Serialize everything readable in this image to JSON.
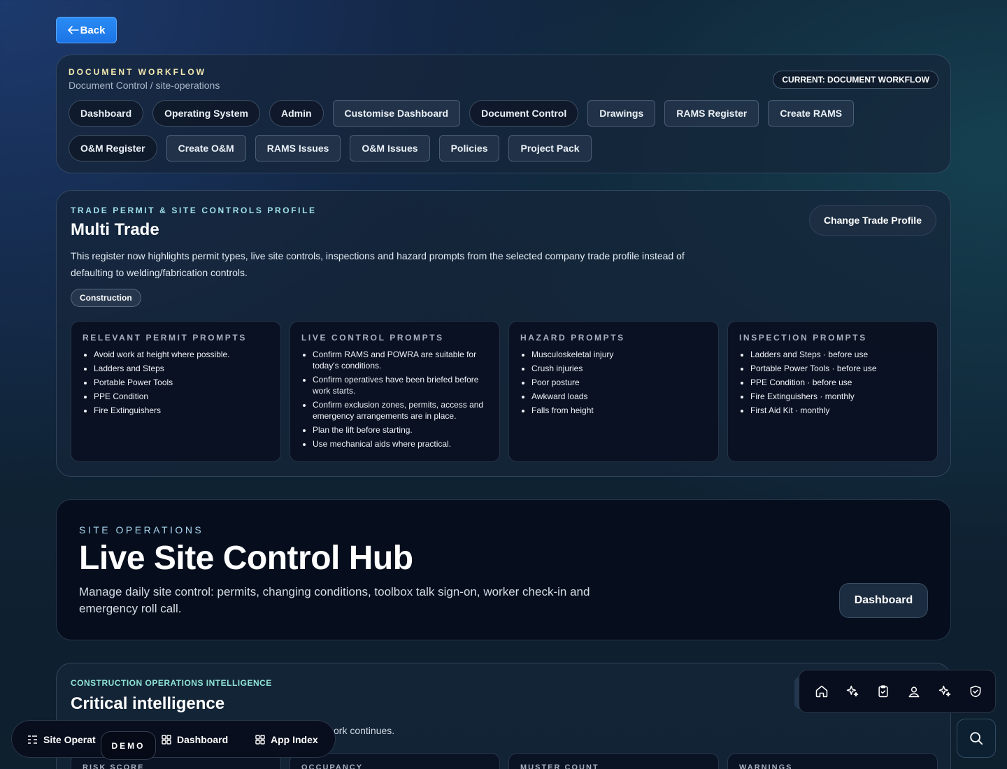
{
  "back": {
    "label": "Back"
  },
  "workflow": {
    "eyebrow": "DOCUMENT WORKFLOW",
    "path": "Document Control / site-operations",
    "current": "CURRENT: DOCUMENT WORKFLOW",
    "chips": [
      {
        "label": "Dashboard"
      },
      {
        "label": "Operating System"
      },
      {
        "label": "Admin"
      },
      {
        "label": "Customise Dashboard"
      },
      {
        "label": "Document Control"
      },
      {
        "label": "Drawings"
      },
      {
        "label": "RAMS Register"
      },
      {
        "label": "Create RAMS"
      },
      {
        "label": "O&M Register"
      },
      {
        "label": "Create O&M"
      },
      {
        "label": "RAMS Issues"
      },
      {
        "label": "O&M Issues"
      },
      {
        "label": "Policies"
      },
      {
        "label": "Project Pack"
      }
    ]
  },
  "trade_profile": {
    "eyebrow": "TRADE PERMIT & SITE CONTROLS PROFILE",
    "title": "Multi Trade",
    "description": "This register now highlights permit types, live site controls, inspections and hazard prompts from the selected company trade profile instead of defaulting to welding/fabrication controls.",
    "change_button": "Change Trade Profile",
    "tag": "Construction",
    "cards": [
      {
        "heading": "RELEVANT PERMIT PROMPTS",
        "items": [
          "Avoid work at height where possible.",
          "Ladders and Steps",
          "Portable Power Tools",
          "PPE Condition",
          "Fire Extinguishers"
        ]
      },
      {
        "heading": "LIVE CONTROL PROMPTS",
        "items": [
          "Confirm RAMS and POWRA are suitable for today's conditions.",
          "Confirm operatives have been briefed before work starts.",
          "Confirm exclusion zones, permits, access and emergency arrangements are in place.",
          "Plan the lift before starting.",
          "Use mechanical aids where practical."
        ]
      },
      {
        "heading": "HAZARD PROMPTS",
        "items": [
          "Musculoskeletal injury",
          "Crush injuries",
          "Poor posture",
          "Awkward loads",
          "Falls from height"
        ]
      },
      {
        "heading": "INSPECTION PROMPTS",
        "items": [
          "Ladders and Steps · before use",
          "Portable Power Tools · before use",
          "PPE Condition · before use",
          "Fire Extinguishers · monthly",
          "First Aid Kit · monthly"
        ]
      }
    ]
  },
  "hub": {
    "eyebrow": "SITE OPERATIONS",
    "title": "Live Site Control Hub",
    "description": "Manage daily site control: permits, changing conditions, toolbox talk sign-on, worker check-in and emergency roll call.",
    "button": "Dashboard"
  },
  "intelligence": {
    "eyebrow": "CONSTRUCTION OPERATIONS INTELLIGENCE",
    "title": "Critical intelligence",
    "description_fragment": "ork continues.",
    "cards": [
      "RISK SCORE",
      "OCCUPANCY",
      "MUSTER COUNT",
      "WARNINGS"
    ]
  },
  "dock": {
    "items": [
      {
        "label": "Site Operat",
        "icon": "list-tree-icon"
      },
      {
        "label": "Dashboard",
        "icon": "grid-icon"
      },
      {
        "label": "App Index",
        "icon": "grid-icon"
      }
    ],
    "badge": "DEMO"
  },
  "toolbar": {
    "icons": [
      "home-icon",
      "sparkles-icon",
      "clipboard-check-icon",
      "user-pin-icon",
      "sparkles-icon",
      "shield-check-icon"
    ]
  },
  "search": {
    "icon": "search-icon"
  },
  "colors": {
    "accent": "#2a8cf5",
    "eyebrow_gold": "#f4e9b0",
    "eyebrow_teal": "#9fe0e8"
  }
}
